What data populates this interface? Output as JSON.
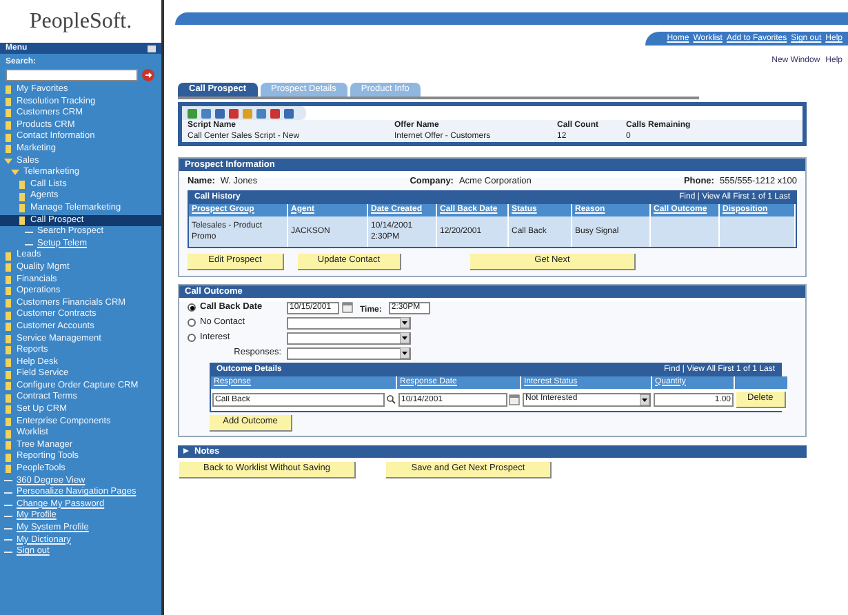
{
  "logo": "PeopleSoft.",
  "menu": {
    "title": "Menu",
    "search_label": "Search:",
    "items": [
      {
        "label": "My Favorites",
        "expanded": false,
        "selected": false
      },
      {
        "label": "Resolution Tracking",
        "expanded": false,
        "selected": false
      },
      {
        "label": "Customers CRM",
        "expanded": false,
        "selected": false
      },
      {
        "label": "Products CRM",
        "expanded": false,
        "selected": false
      },
      {
        "label": "Contact Information",
        "expanded": false,
        "selected": false
      },
      {
        "label": "Marketing",
        "expanded": false,
        "selected": false
      },
      {
        "label": "Sales",
        "expanded": true,
        "selected": false,
        "children": [
          {
            "label": "Telemarketing",
            "expanded": true,
            "selected": false,
            "children": [
              {
                "label": "Call Lists",
                "expanded": false,
                "selected": false
              },
              {
                "label": "Agents",
                "expanded": false,
                "selected": false
              },
              {
                "label": "Manage Telemarketing",
                "expanded": false,
                "selected": false
              },
              {
                "label": "Call Prospect",
                "expanded": false,
                "selected": true,
                "children": [
                  {
                    "label": "Search Prospect",
                    "kind": "page",
                    "selected": false
                  },
                  {
                    "label": "Setup Telem",
                    "kind": "link",
                    "selected": false
                  }
                ]
              }
            ]
          }
        ]
      },
      {
        "label": "Leads",
        "expanded": false,
        "selected": false
      },
      {
        "label": "Quality Mgmt",
        "expanded": false,
        "selected": false
      },
      {
        "label": "Financials",
        "expanded": false,
        "selected": false
      },
      {
        "label": "Operations",
        "expanded": false,
        "selected": false
      },
      {
        "label": "Customers Financials CRM",
        "expanded": false,
        "selected": false
      },
      {
        "label": "Customer Contracts",
        "expanded": false,
        "selected": false
      },
      {
        "label": "Customer Accounts",
        "expanded": false,
        "selected": false
      },
      {
        "label": "Service Management",
        "expanded": false,
        "selected": false
      },
      {
        "label": "Reports",
        "expanded": false,
        "selected": false
      },
      {
        "label": "Help Desk",
        "expanded": false,
        "selected": false
      },
      {
        "label": "Field Service",
        "expanded": false,
        "selected": false
      },
      {
        "label": "Configure Order Capture CRM",
        "expanded": false,
        "selected": false
      },
      {
        "label": "Contract Terms",
        "expanded": false,
        "selected": false
      },
      {
        "label": "Set Up CRM",
        "expanded": false,
        "selected": false
      },
      {
        "label": "Enterprise Components",
        "expanded": false,
        "selected": false
      },
      {
        "label": "Worklist",
        "expanded": false,
        "selected": false
      },
      {
        "label": "Tree Manager",
        "expanded": false,
        "selected": false
      },
      {
        "label": "Reporting Tools",
        "expanded": false,
        "selected": false
      },
      {
        "label": "PeopleTools",
        "expanded": false,
        "selected": false
      },
      {
        "label": "360 Degree View",
        "kind": "link",
        "selected": false
      },
      {
        "label": "Personalize Navigation Pages",
        "kind": "link",
        "selected": false
      },
      {
        "label": "Change My Password",
        "kind": "link",
        "selected": false
      },
      {
        "label": "My Profile",
        "kind": "link",
        "selected": false
      },
      {
        "label": "My System Profile",
        "kind": "link",
        "selected": false
      },
      {
        "label": "My Dictionary",
        "kind": "link",
        "selected": false
      },
      {
        "label": "Sign out",
        "kind": "link",
        "selected": false
      }
    ]
  },
  "header_links": [
    "Home",
    "Worklist",
    "Add to Favorites",
    "Sign out",
    "Help"
  ],
  "page_links": [
    "New Window",
    "Help"
  ],
  "tabs": [
    {
      "label": "Call Prospect",
      "selected": true
    },
    {
      "label": "Prospect Details",
      "selected": false
    },
    {
      "label": "Product Info",
      "selected": false
    }
  ],
  "script_bar": {
    "columns": [
      "Script Name",
      "Offer Name",
      "Call Count",
      "Calls Remaining"
    ],
    "values": [
      "Call Center Sales Script - New",
      "Internet Offer - Customers",
      "12",
      "0"
    ]
  },
  "prospect": {
    "title": "Prospect Information",
    "fields": [
      {
        "label": "Name:",
        "value": "W. Jones"
      },
      {
        "label": "Company:",
        "value": "Acme Corporation"
      },
      {
        "label": "Phone:",
        "value": "555/555-1212 x100"
      }
    ],
    "grid": {
      "title": "Call History",
      "nav": "Find | View All   First 1 of 1 Last",
      "columns": [
        "Prospect Group",
        "Agent",
        "Date Created",
        "Call Back Date",
        "Status",
        "Reason",
        "Call Outcome",
        "Disposition"
      ],
      "rows": [
        [
          "Telesales - Product Promo",
          "JACKSON",
          "10/14/2001 2:30PM",
          "12/20/2001",
          "Call Back",
          "Busy Signal",
          "",
          ""
        ]
      ]
    },
    "buttons": [
      "Edit Prospect",
      "Update Contact",
      "Get Next"
    ]
  },
  "outcome": {
    "title": "Call Outcome",
    "options": [
      {
        "kind": "date",
        "label": "Call Back Date",
        "selected": true,
        "value": "10/15/2001",
        "time_label": "Time:",
        "time": "2:30PM"
      },
      {
        "kind": "select",
        "label": "No Contact",
        "selected": false
      },
      {
        "kind": "select",
        "label": "Interest",
        "selected": false
      },
      {
        "kind": "sub",
        "label": "Responses:"
      }
    ],
    "grid": {
      "title": "Outcome Details",
      "nav": "Find | View All   First 1 of 1 Last",
      "columns": [
        "Response",
        "Response Date",
        "Interest Status",
        "Quantity"
      ],
      "rows": [
        {
          "response": "Call Back",
          "date": "10/14/2001",
          "status": "Not Interested",
          "quantity": "1.00"
        }
      ],
      "row_button": "Delete"
    },
    "add_button": "Add Outcome"
  },
  "notes": {
    "title": "Notes",
    "expanded": false
  },
  "footer_buttons": [
    "Back to Worklist Without Saving",
    "Save and Get Next Prospect"
  ]
}
